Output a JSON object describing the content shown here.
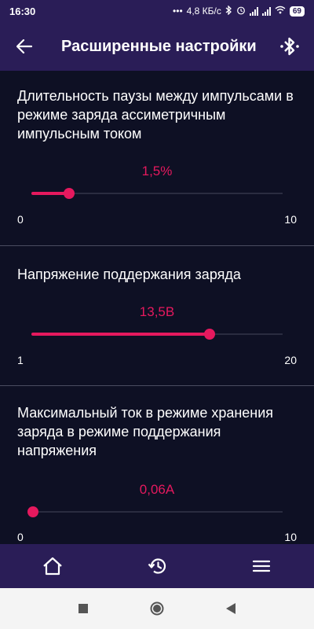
{
  "status_bar": {
    "time": "16:30",
    "dots": "•••",
    "net_speed": "4,8 КБ/с",
    "battery": "69"
  },
  "app_bar": {
    "title": "Расширенные настройки",
    "back_icon": "arrow-left-icon",
    "bluetooth_icon": "bluetooth-icon"
  },
  "settings": [
    {
      "title": "Длительность паузы между импульсами в режиме заряда ассиметричным импульсным током",
      "value": "1,5%",
      "min": "0",
      "max": "10",
      "level": 0.15
    },
    {
      "title": "Напряжение поддержания заряда",
      "value": "13,5В",
      "min": "1",
      "max": "20",
      "level": 0.71
    },
    {
      "title": "Максимальный ток в режиме хранения заряда в режиме поддержания напряжения",
      "value": "0,06А",
      "min": "0",
      "max": "10",
      "level": 0.006
    }
  ],
  "bottom_nav": {
    "items": [
      "home-icon",
      "history-icon",
      "menu-icon"
    ]
  },
  "system_nav": {
    "items": [
      "recents-square-icon",
      "home-circle-icon",
      "back-triangle-icon"
    ]
  },
  "colors": {
    "accent": "#e5195e",
    "bar": "#2a1d57",
    "background": "#0e1024"
  }
}
